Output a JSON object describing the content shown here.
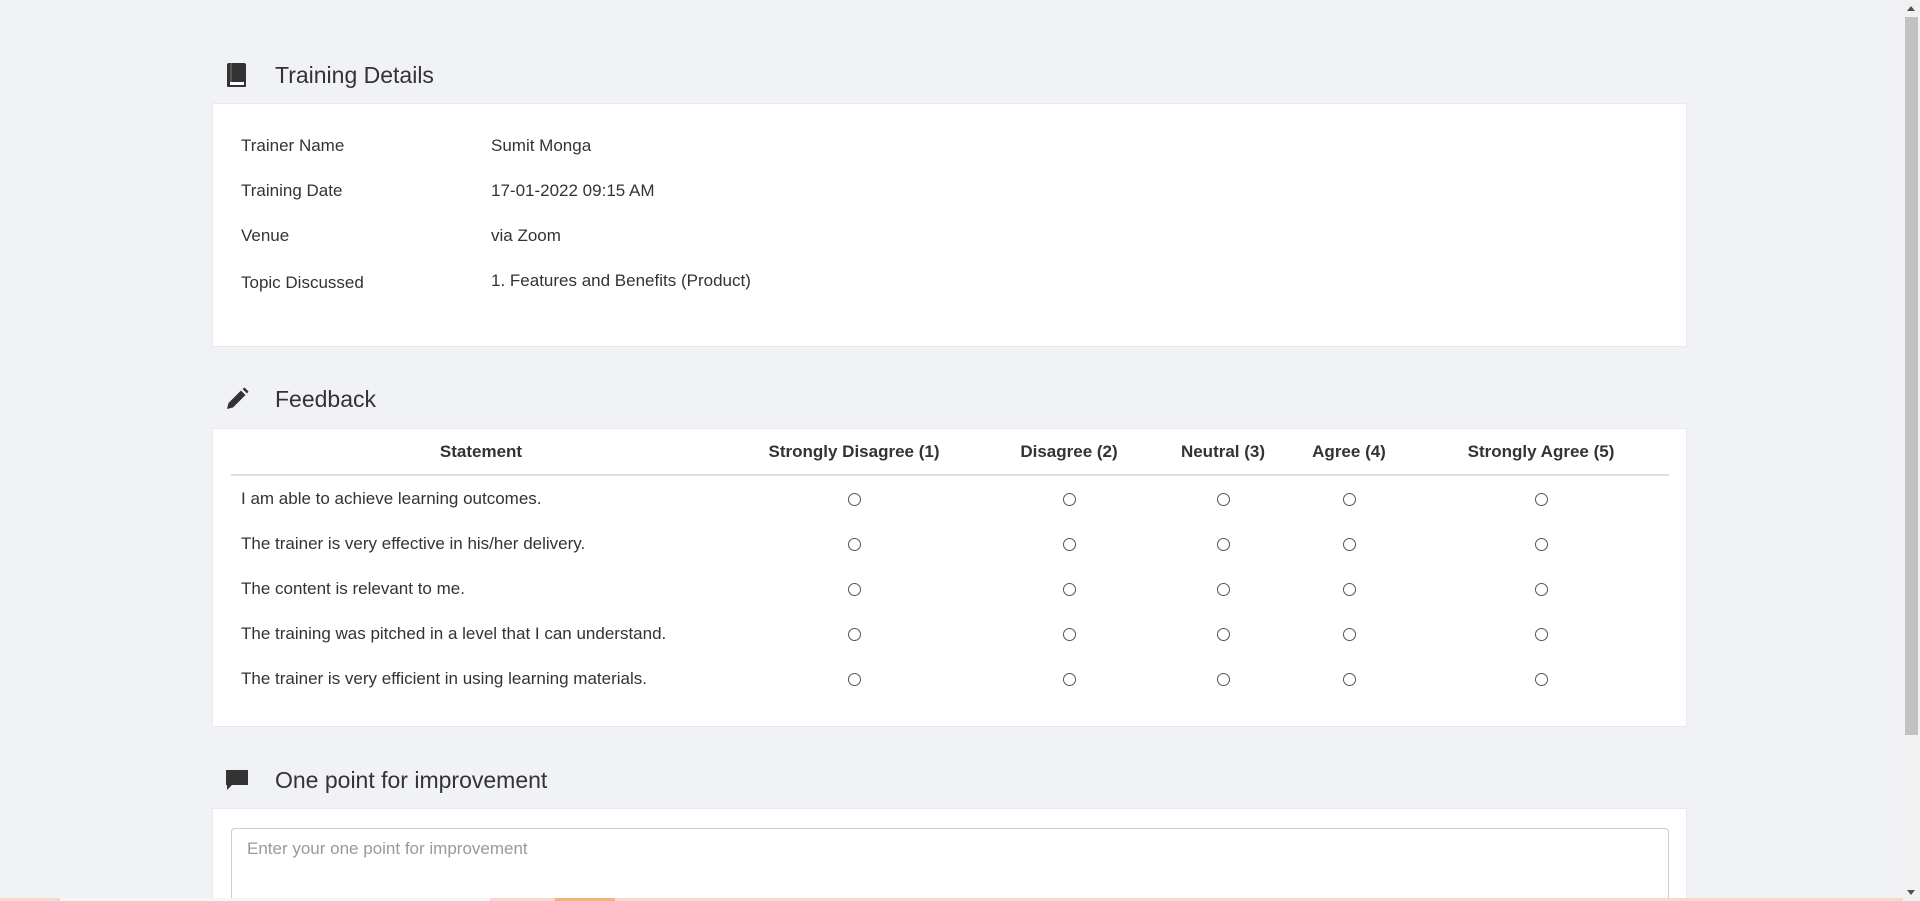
{
  "training": {
    "heading": "Training Details",
    "icon": "book-icon",
    "rows": [
      {
        "label": "Trainer Name",
        "value": "Sumit Monga"
      },
      {
        "label": "Training Date",
        "value": "17-01-2022 09:15 AM"
      },
      {
        "label": "Venue",
        "value": "via Zoom"
      },
      {
        "label": "Topic Discussed",
        "value": "1. Features and Benefits (Product)"
      }
    ]
  },
  "feedback": {
    "heading": "Feedback",
    "icon": "pencil-icon",
    "columns": [
      "Statement",
      "Strongly Disagree (1)",
      "Disagree (2)",
      "Neutral (3)",
      "Agree (4)",
      "Strongly Agree (5)"
    ],
    "statements": [
      "I am able to achieve learning outcomes.",
      "The trainer is very effective in his/her delivery.",
      "The content is relevant to me.",
      "The training was pitched in a level that I can understand.",
      "The trainer is very efficient in using learning materials."
    ]
  },
  "improvement": {
    "heading": "One point for improvement",
    "icon": "comment-icon",
    "placeholder": "Enter your one point for improvement",
    "value": ""
  },
  "colors": {
    "background": "#f1f2f6",
    "card": "#ffffff",
    "text": "#333333"
  }
}
